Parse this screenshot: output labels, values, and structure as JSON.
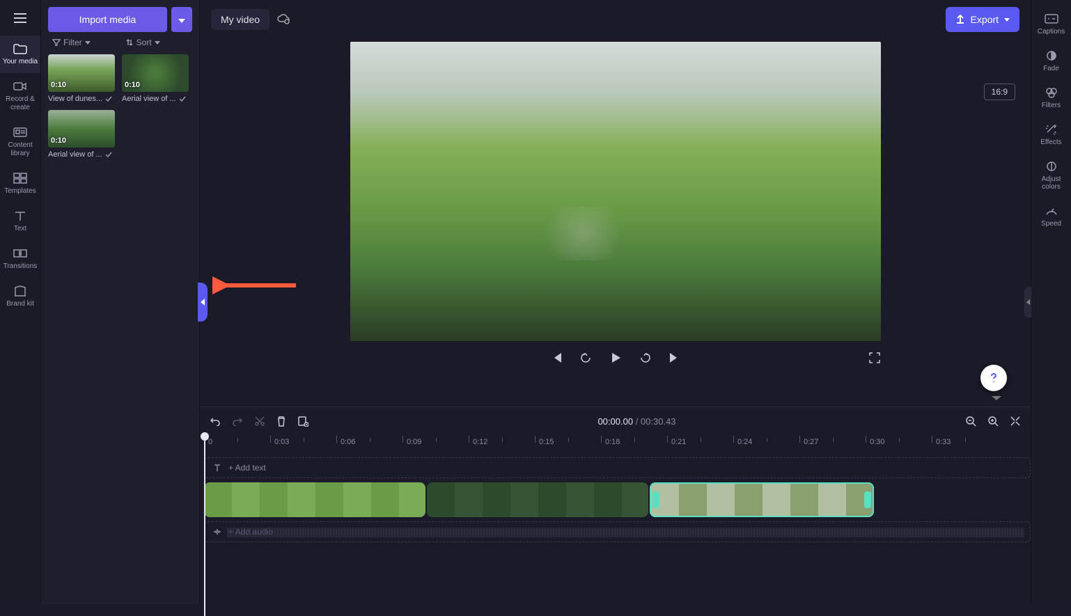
{
  "header": {
    "project_title": "My video",
    "export_label": "Export",
    "aspect_ratio": "16:9"
  },
  "left_nav": {
    "items": [
      {
        "label": "Your media"
      },
      {
        "label": "Record & create"
      },
      {
        "label": "Content library"
      },
      {
        "label": "Templates"
      },
      {
        "label": "Text"
      },
      {
        "label": "Transitions"
      },
      {
        "label": "Brand kit"
      }
    ]
  },
  "media_panel": {
    "import_label": "Import media",
    "filter_label": "Filter",
    "sort_label": "Sort",
    "clips": [
      {
        "duration": "0:10",
        "caption": "View of dunes..."
      },
      {
        "duration": "0:10",
        "caption": "Aerial view of ..."
      },
      {
        "duration": "0:10",
        "caption": "Aerial view of ..."
      }
    ]
  },
  "right_nav": {
    "items": [
      {
        "label": "Captions"
      },
      {
        "label": "Fade"
      },
      {
        "label": "Filters"
      },
      {
        "label": "Effects"
      },
      {
        "label": "Adjust colors"
      },
      {
        "label": "Speed"
      }
    ]
  },
  "timeline": {
    "current_time": "00:00.00",
    "total_time": "00:30.43",
    "ruler": [
      "0",
      "0:03",
      "0:06",
      "0:09",
      "0:12",
      "0:15",
      "0:18",
      "0:21",
      "0:24",
      "0:27",
      "0:30",
      "0:33"
    ],
    "text_track_hint": "+ Add text",
    "audio_track_hint": "+ Add audio"
  }
}
